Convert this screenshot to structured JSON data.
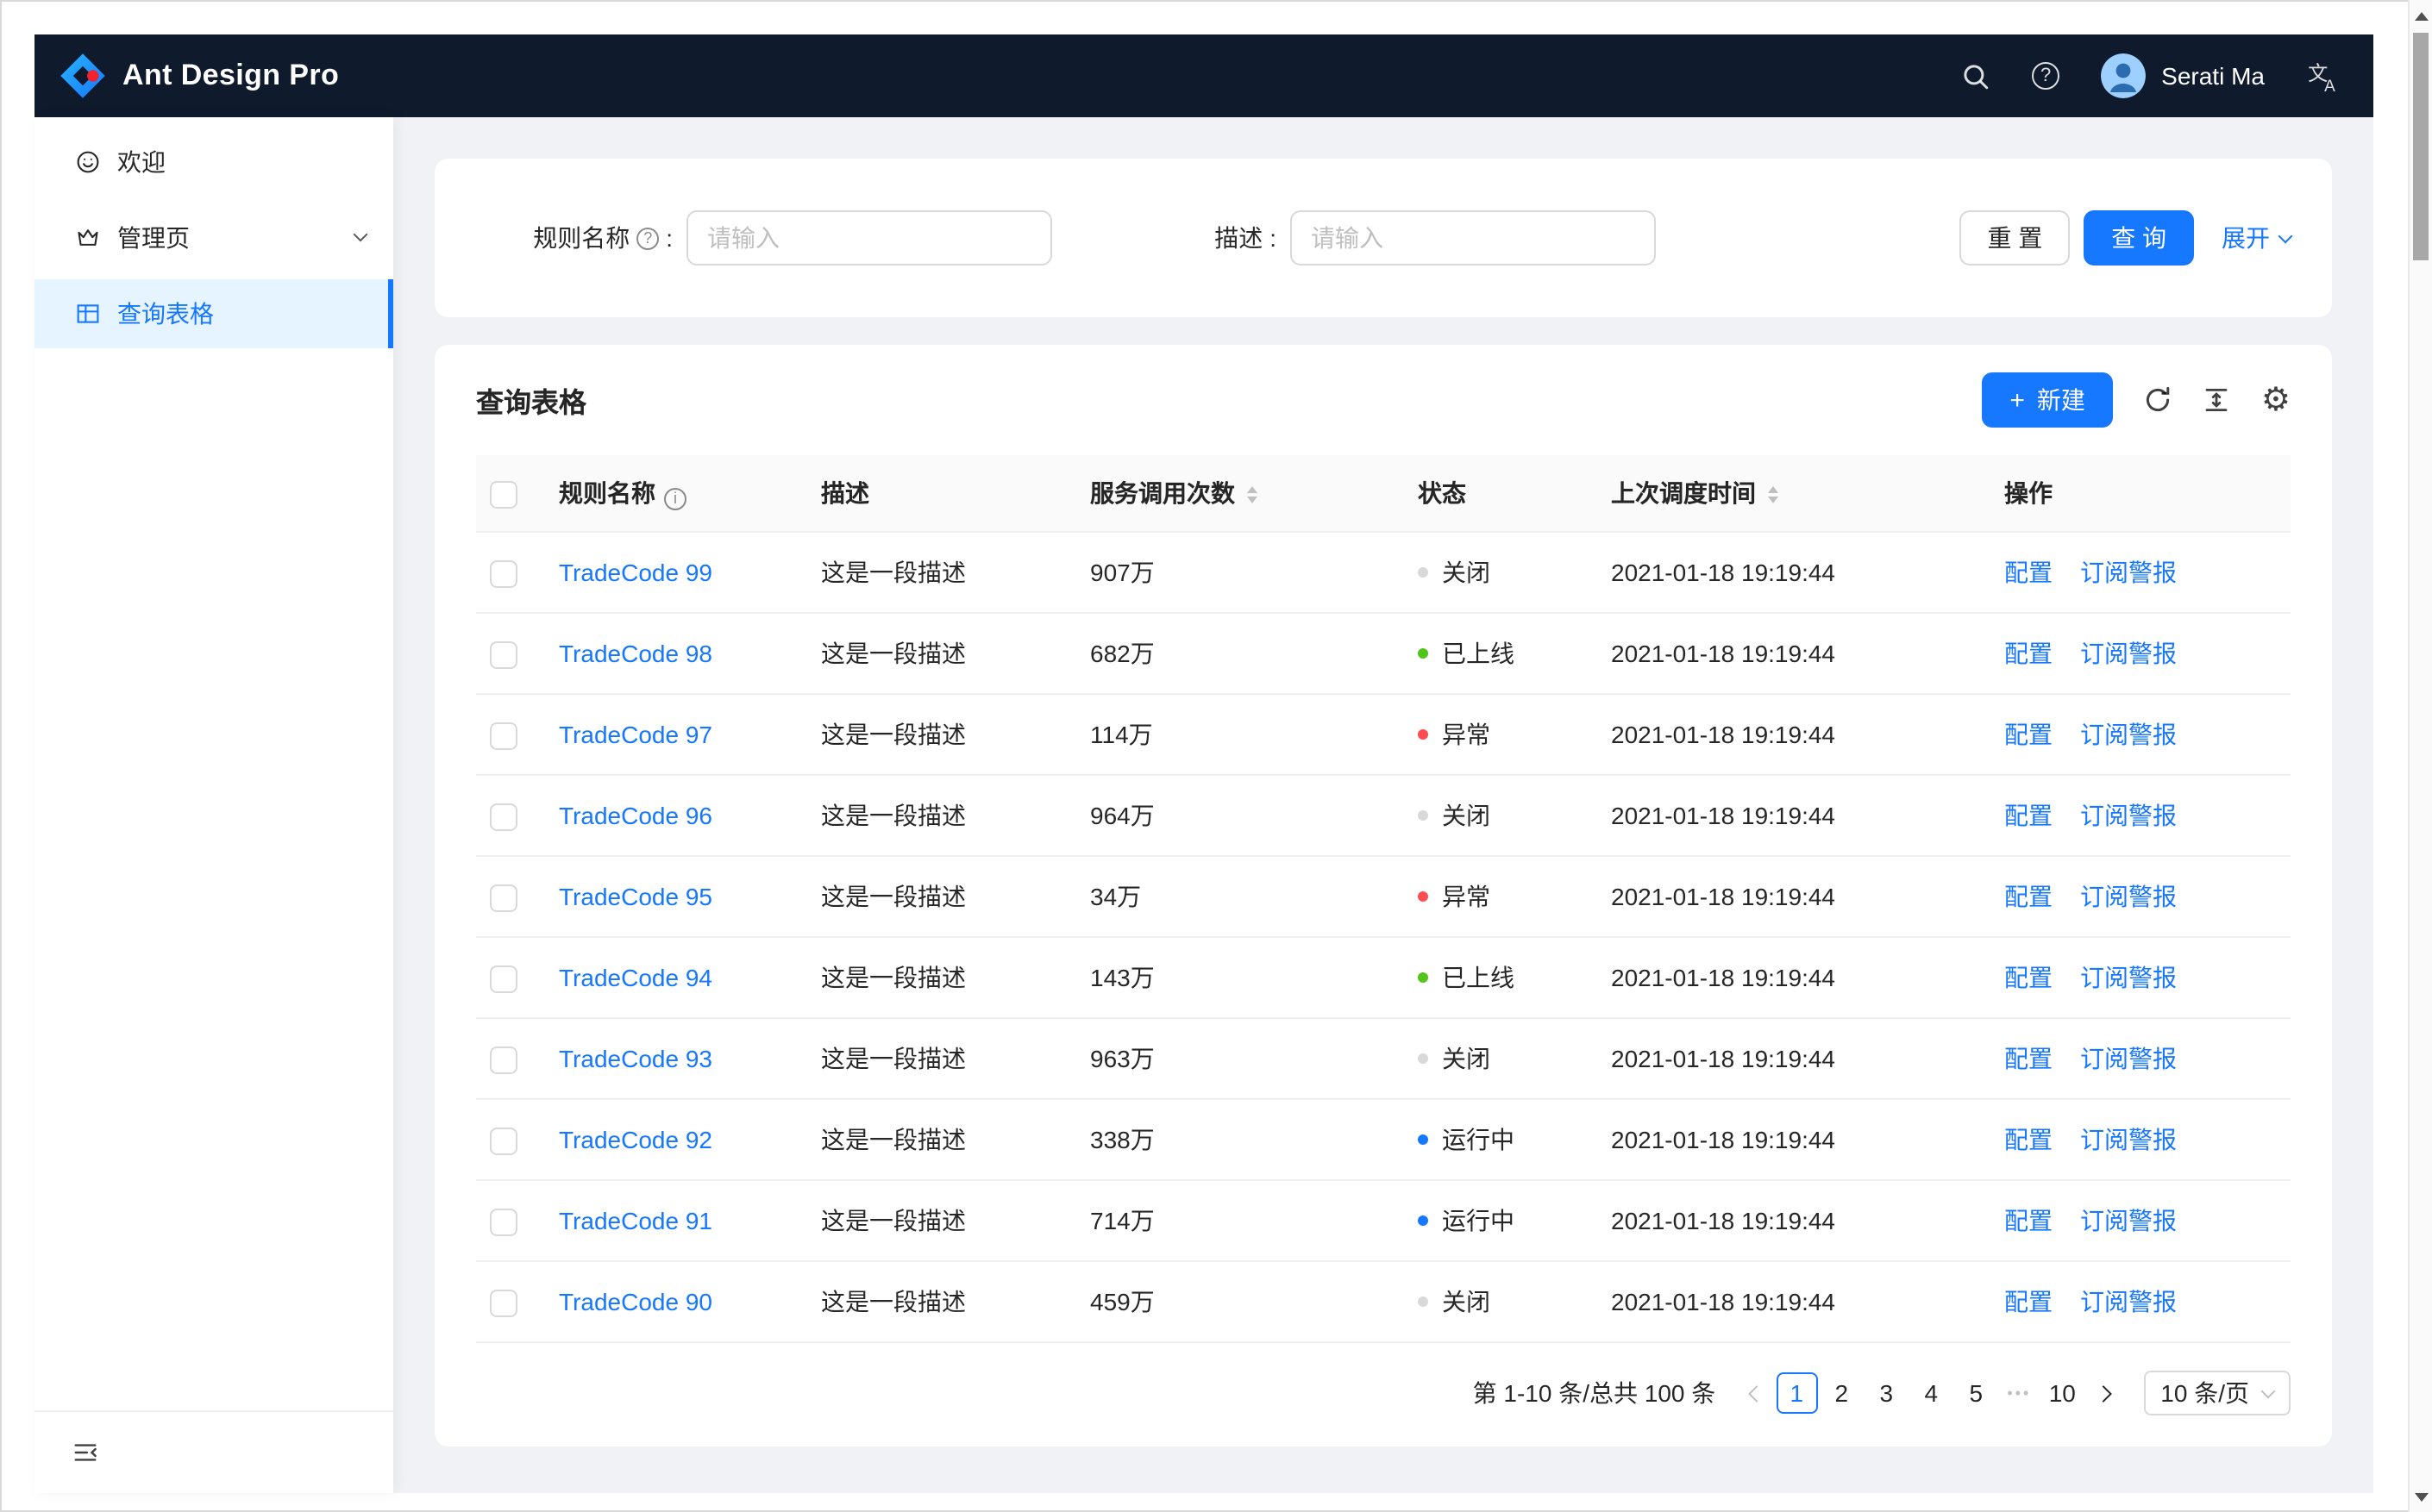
{
  "colors": {
    "primary": "#1677ff",
    "header_bg": "#0f1b2d",
    "selected_bg": "#e6f4ff",
    "status": {
      "default": "#d9d9d9",
      "success": "#52c41a",
      "error": "#ff4d4f",
      "processing": "#1677ff"
    }
  },
  "header": {
    "title": "Ant Design Pro",
    "user_name": "Serati Ma"
  },
  "sidebar": {
    "items": [
      {
        "id": "welcome",
        "label": "欢迎",
        "icon": "smile-icon",
        "selected": false
      },
      {
        "id": "admin",
        "label": "管理页",
        "icon": "crown-icon",
        "selected": false,
        "has_arrow": true
      },
      {
        "id": "table-list",
        "label": "查询表格",
        "icon": "table-icon",
        "selected": true
      }
    ]
  },
  "filter": {
    "colon": ":",
    "fields": [
      {
        "label": "规则名称",
        "placeholder": "请输入",
        "has_tooltip": true
      },
      {
        "label": "描述",
        "placeholder": "请输入",
        "has_tooltip": false
      }
    ],
    "reset_label": "重 置",
    "search_label": "查 询",
    "expand_label": "展开"
  },
  "toolbar": {
    "title": "查询表格",
    "new_label": "新建"
  },
  "table": {
    "columns": [
      {
        "label": "规则名称",
        "info": true
      },
      {
        "label": "描述"
      },
      {
        "label": "服务调用次数",
        "sortable": true
      },
      {
        "label": "状态"
      },
      {
        "label": "上次调度时间",
        "sortable": true
      },
      {
        "label": "操作"
      }
    ],
    "rows": [
      {
        "name": "TradeCode 99",
        "desc": "这是一段描述",
        "calls": "907万",
        "status": "关闭",
        "status_type": "default",
        "time": "2021-01-18 19:19:44",
        "actions": [
          "配置",
          "订阅警报"
        ]
      },
      {
        "name": "TradeCode 98",
        "desc": "这是一段描述",
        "calls": "682万",
        "status": "已上线",
        "status_type": "success",
        "time": "2021-01-18 19:19:44",
        "actions": [
          "配置",
          "订阅警报"
        ]
      },
      {
        "name": "TradeCode 97",
        "desc": "这是一段描述",
        "calls": "114万",
        "status": "异常",
        "status_type": "error",
        "time": "2021-01-18 19:19:44",
        "actions": [
          "配置",
          "订阅警报"
        ]
      },
      {
        "name": "TradeCode 96",
        "desc": "这是一段描述",
        "calls": "964万",
        "status": "关闭",
        "status_type": "default",
        "time": "2021-01-18 19:19:44",
        "actions": [
          "配置",
          "订阅警报"
        ]
      },
      {
        "name": "TradeCode 95",
        "desc": "这是一段描述",
        "calls": "34万",
        "status": "异常",
        "status_type": "error",
        "time": "2021-01-18 19:19:44",
        "actions": [
          "配置",
          "订阅警报"
        ]
      },
      {
        "name": "TradeCode 94",
        "desc": "这是一段描述",
        "calls": "143万",
        "status": "已上线",
        "status_type": "success",
        "time": "2021-01-18 19:19:44",
        "actions": [
          "配置",
          "订阅警报"
        ]
      },
      {
        "name": "TradeCode 93",
        "desc": "这是一段描述",
        "calls": "963万",
        "status": "关闭",
        "status_type": "default",
        "time": "2021-01-18 19:19:44",
        "actions": [
          "配置",
          "订阅警报"
        ]
      },
      {
        "name": "TradeCode 92",
        "desc": "这是一段描述",
        "calls": "338万",
        "status": "运行中",
        "status_type": "processing",
        "time": "2021-01-18 19:19:44",
        "actions": [
          "配置",
          "订阅警报"
        ]
      },
      {
        "name": "TradeCode 91",
        "desc": "这是一段描述",
        "calls": "714万",
        "status": "运行中",
        "status_type": "processing",
        "time": "2021-01-18 19:19:44",
        "actions": [
          "配置",
          "订阅警报"
        ]
      },
      {
        "name": "TradeCode 90",
        "desc": "这是一段描述",
        "calls": "459万",
        "status": "关闭",
        "status_type": "default",
        "time": "2021-01-18 19:19:44",
        "actions": [
          "配置",
          "订阅警报"
        ]
      }
    ]
  },
  "pagination": {
    "total_text": "第 1-10 条/总共 100 条",
    "active_page": "1",
    "pages": [
      "1",
      "2",
      "3",
      "4",
      "5"
    ],
    "jump_ellipsis": "•••",
    "last_page": "10",
    "page_size_label": "10 条/页"
  }
}
